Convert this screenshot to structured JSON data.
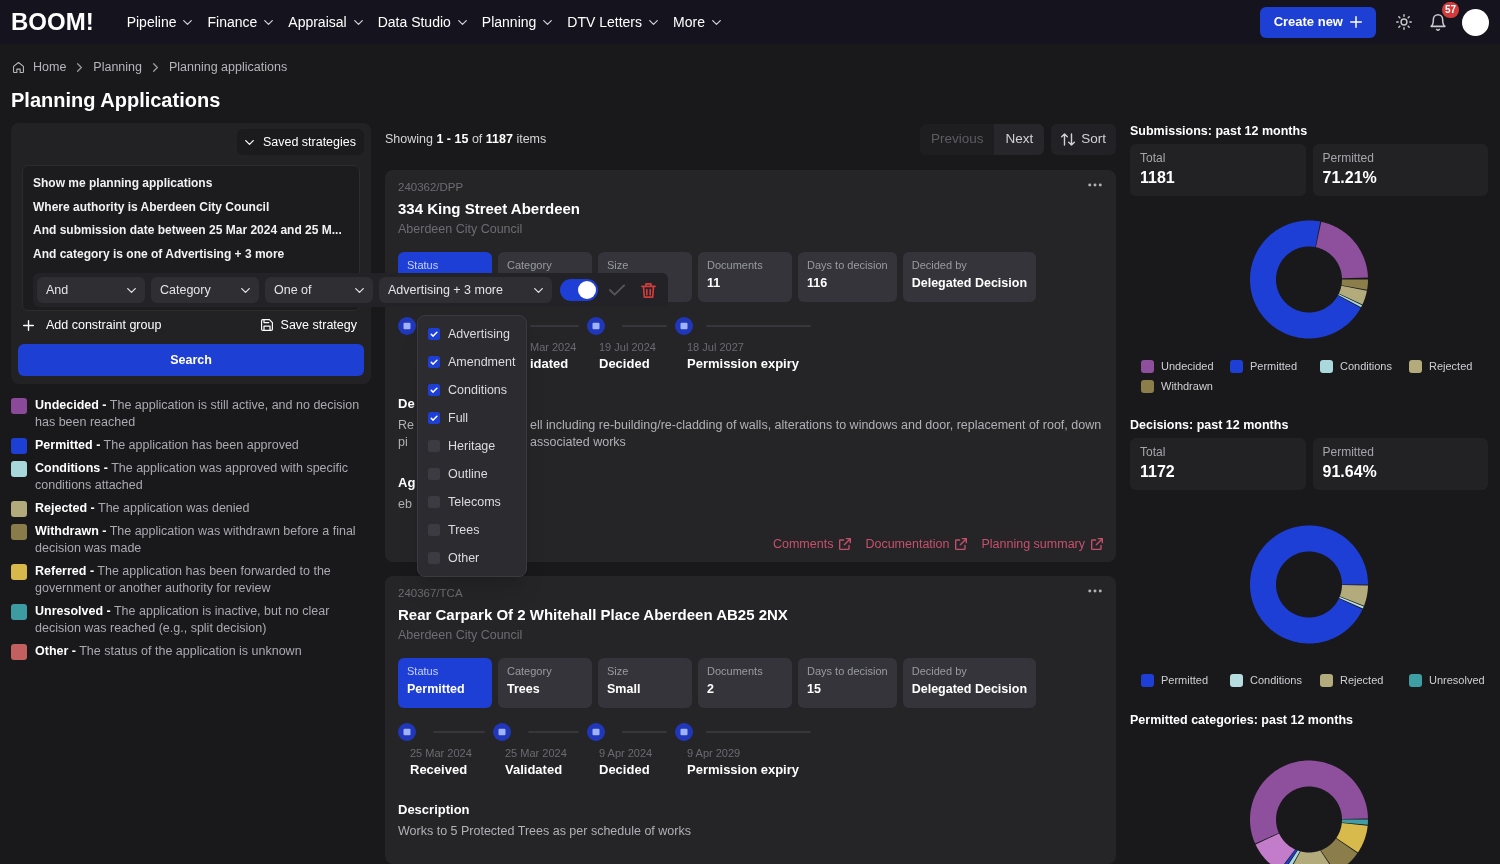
{
  "nav": {
    "logo": "BOOM!",
    "menus": [
      "Pipeline",
      "Finance",
      "Appraisal",
      "Data Studio",
      "Planning",
      "DTV Letters",
      "More"
    ],
    "create_button": "Create new",
    "notification_count": "57"
  },
  "breadcrumb": [
    "Home",
    "Planning",
    "Planning applications"
  ],
  "page_title": "Planning Applications",
  "strategy_panel": {
    "saved_strategies": "Saved strategies",
    "query_lines": [
      "Show me planning applications",
      "Where authority is Aberdeen City Council",
      "And submission date between 25 Mar 2024 and 25 M...",
      "And category is one of Advertising + 3 more"
    ],
    "constraint_selects": [
      "And",
      "Category",
      "One of",
      "Advertising + 3 more"
    ],
    "toggle": {
      "on": true
    },
    "category_menu": [
      {
        "label": "Advertising",
        "checked": true
      },
      {
        "label": "Amendment",
        "checked": true
      },
      {
        "label": "Conditions",
        "checked": true
      },
      {
        "label": "Full",
        "checked": true
      },
      {
        "label": "Heritage",
        "checked": false
      },
      {
        "label": "Outline",
        "checked": false
      },
      {
        "label": "Telecoms",
        "checked": false
      },
      {
        "label": "Trees",
        "checked": false
      },
      {
        "label": "Other",
        "checked": false
      }
    ],
    "add_group": "Add constraint group",
    "save_strategy": "Save strategy",
    "search": "Search"
  },
  "status_legend": [
    {
      "text": "**Undecided -** The application is still active, and no decision has been reached",
      "color": "#8b4a99"
    },
    {
      "text": "**Permitted -** The application has been approved",
      "color": "#1d3fd4"
    },
    {
      "text": "**Conditions -** The application was approved with specific conditions attached",
      "color": "#a8d8dc"
    },
    {
      "text": "**Rejected -** The application was denied",
      "color": "#b3aa7b"
    },
    {
      "text": "**Withdrawn -** The application was withdrawn before a final decision was made",
      "color": "#8a7c4a"
    },
    {
      "text": "**Referred -** The application has been forwarded to the government or another authority for review",
      "color": "#d7b84a"
    },
    {
      "text": "**Unresolved -** The application is inactive, but no clear decision was reached (e.g., split decision)",
      "color": "#3d9ca2"
    },
    {
      "text": "**Other -** The status of the application is unknown",
      "color": "#c25f5f"
    }
  ],
  "results": {
    "summary": "Showing **1 - 15** of **1187** items",
    "pagination": [
      {
        "label": "Previous",
        "disabled": true
      },
      {
        "label": "Next",
        "disabled": false
      }
    ],
    "sort": "Sort"
  },
  "applications": [
    {
      "ref": "240362/DPP",
      "title": "334 King Street Aberdeen",
      "authority": "Aberdeen City Council",
      "tiles": [
        {
          "kind": "status",
          "label": "Status"
        },
        {
          "kind": "plain",
          "label": "Category"
        },
        {
          "kind": "plain",
          "label": "Size"
        },
        {
          "kind": "plain",
          "label": "Documents",
          "value": "11"
        },
        {
          "kind": "plain",
          "label": "Days to decision",
          "value": "116"
        },
        {
          "kind": "plain",
          "label": "Decided by",
          "value": "Delegated Decision"
        }
      ],
      "timeline": [
        {
          "kind": "icon"
        },
        {
          "kind": "clipped",
          "date": "Mar 2024",
          "label": "idated"
        },
        {
          "kind": "step",
          "date": "19 Jul 2024",
          "label": "Decided"
        },
        {
          "kind": "step",
          "date": "18 Jul 2027",
          "label": "Permission expiry"
        }
      ],
      "sections": [
        {
          "heading": "De",
          "fragments": [
            {
              "left": "Re",
              "right": "ell including re-building/re-cladding of walls, alterations to windows and door, replacement of roof, down"
            },
            {
              "left": "pi",
              "right": "associated works"
            }
          ]
        },
        {
          "heading": "Ag",
          "fragments": [
            {
              "left": "eb"
            }
          ]
        }
      ],
      "links": [
        "Comments",
        "Documentation",
        "Planning summary"
      ]
    },
    {
      "ref": "240367/TCA",
      "title": "Rear Carpark Of 2 Whitehall Place Aberdeen AB25 2NX",
      "authority": "Aberdeen City Council",
      "tiles": [
        {
          "kind": "status",
          "label": "Status",
          "value": "Permitted"
        },
        {
          "kind": "plain",
          "label": "Category",
          "value": "Trees"
        },
        {
          "kind": "plain",
          "label": "Size",
          "value": "Small"
        },
        {
          "kind": "plain",
          "label": "Documents",
          "value": "2"
        },
        {
          "kind": "plain",
          "label": "Days to decision",
          "value": "15"
        },
        {
          "kind": "plain",
          "label": "Decided by",
          "value": "Delegated Decision"
        }
      ],
      "timeline": [
        {
          "kind": "step",
          "date": "25 Mar 2024",
          "label": "Received"
        },
        {
          "kind": "step",
          "date": "25 Mar 2024",
          "label": "Validated"
        },
        {
          "kind": "step",
          "date": "9 Apr 2024",
          "label": "Decided"
        },
        {
          "kind": "step",
          "date": "9 Apr 2029",
          "label": "Permission expiry"
        }
      ],
      "sections": [
        {
          "heading": "Description",
          "text": "Works to 5 Protected Trees as per schedule of works"
        }
      ]
    }
  ],
  "stats_panels": [
    {
      "title": "Submissions: past 12 months",
      "tiles": [
        {
          "label": "Total",
          "value": "1181"
        },
        {
          "label": "Permitted",
          "value": "71.21%"
        }
      ],
      "legend": [
        {
          "label": "Undecided",
          "color": "#8e4f9c"
        },
        {
          "label": "Permitted",
          "color": "#1e3fd6"
        },
        {
          "label": "Conditions",
          "color": "#a9d9dc"
        },
        {
          "label": "Rejected",
          "color": "#b4ab7c"
        },
        {
          "label": "Withdrawn",
          "color": "#8b7e4b"
        }
      ]
    },
    {
      "title": "Decisions: past 12 months",
      "tiles": [
        {
          "label": "Total",
          "value": "1172"
        },
        {
          "label": "Permitted",
          "value": "91.64%"
        }
      ],
      "legend": [
        {
          "label": "Permitted",
          "color": "#1e3fd6"
        },
        {
          "label": "Conditions",
          "color": "#b8dde0"
        },
        {
          "label": "Rejected",
          "color": "#b4ab7c"
        },
        {
          "label": "Unresolved",
          "color": "#3f9ea3"
        }
      ]
    },
    {
      "title": "Permitted categories: past 12 months"
    }
  ]
}
